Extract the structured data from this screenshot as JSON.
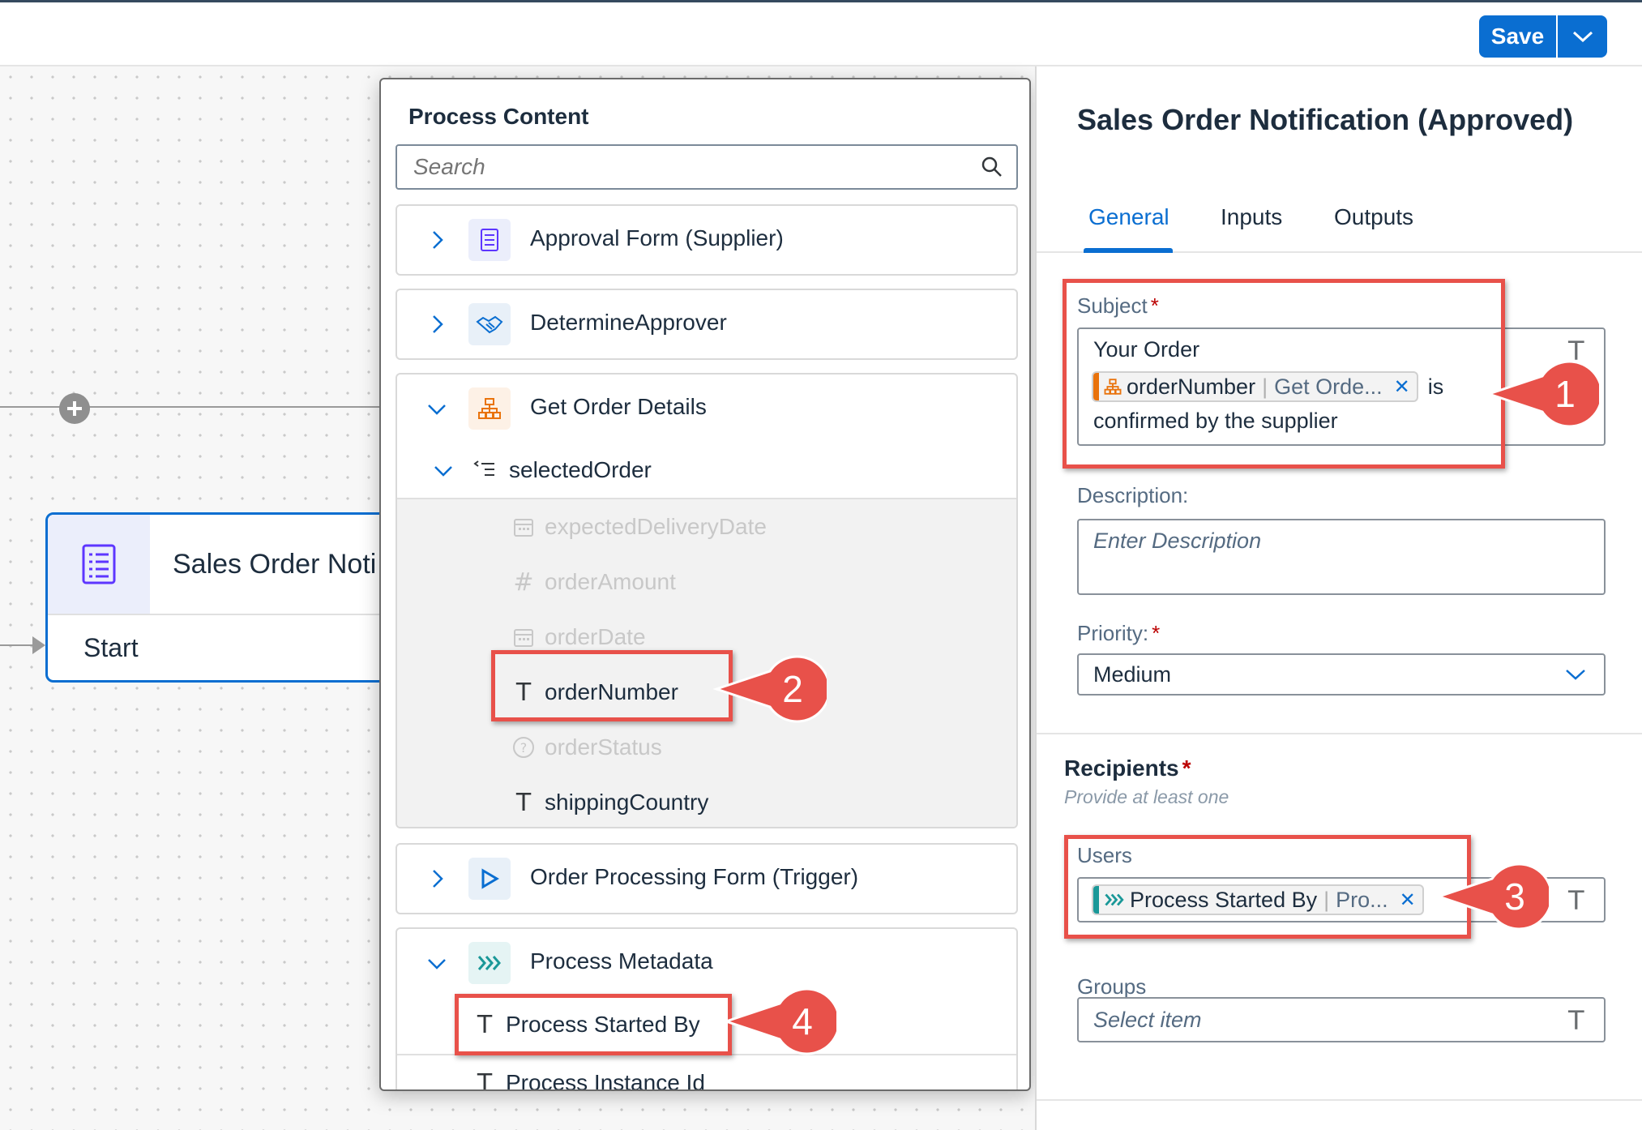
{
  "toolbar": {
    "save_label": "Save",
    "save_menu_icon": "chevron-down-icon",
    "accent_color": "#0a6ed1"
  },
  "canvas": {
    "add_node_icon": "plus-circle-icon",
    "task_card": {
      "title": "Sales Order Noti",
      "icon": "form-list-icon",
      "start_label": "Start"
    }
  },
  "process_content": {
    "title": "Process Content",
    "search_placeholder": "Search",
    "sections": [
      {
        "label": "Approval Form (Supplier)",
        "icon": "form-list-icon",
        "expanded": false
      },
      {
        "label": "DetermineApprover",
        "icon": "handshake-icon",
        "expanded": false
      },
      {
        "label": "Get Order Details",
        "icon": "hierarchy-icon",
        "expanded": true,
        "child_group": {
          "label": "selectedOrder",
          "icon": "list-indent-icon"
        },
        "fields": [
          {
            "label": "expectedDeliveryDate",
            "type_icon": "calendar-icon",
            "enabled": false
          },
          {
            "label": "orderAmount",
            "type_icon": "#",
            "enabled": false
          },
          {
            "label": "orderDate",
            "type_icon": "calendar-icon",
            "enabled": false
          },
          {
            "label": "orderNumber",
            "type_icon": "T",
            "enabled": true
          },
          {
            "label": "orderStatus",
            "type_icon": "question-icon",
            "enabled": false
          },
          {
            "label": "shippingCountry",
            "type_icon": "T",
            "enabled": true
          }
        ]
      },
      {
        "label": "Order Processing Form (Trigger)",
        "icon": "play-icon",
        "expanded": false
      },
      {
        "label": "Process Metadata",
        "icon": "process-arrows-icon",
        "expanded": true,
        "fields": [
          {
            "label": "Process Started By",
            "type_icon": "T"
          },
          {
            "label": "Process Instance Id",
            "type_icon": "T"
          }
        ]
      }
    ]
  },
  "details": {
    "title": "Sales Order Notification (Approved)",
    "tabs": [
      "General",
      "Inputs",
      "Outputs"
    ],
    "active_tab": "General",
    "subject": {
      "label": "Subject",
      "required": "*",
      "text_before": "Your Order",
      "token": {
        "name": "orderNumber",
        "source": "Get Orde...",
        "color": "#e9730c"
      },
      "text_after_token": "is",
      "text_line3": "confirmed by the supplier",
      "type_icon": "T"
    },
    "description": {
      "label": "Description:",
      "placeholder": "Enter Description"
    },
    "priority": {
      "label": "Priority:",
      "required": "*",
      "value": "Medium"
    },
    "recipients": {
      "heading": "Recipients",
      "required": "*",
      "hint": "Provide at least one",
      "users": {
        "label": "Users",
        "token": {
          "name": "Process Started By",
          "source": "Pro...",
          "color": "#1a9898"
        },
        "type_icon": "T"
      },
      "groups": {
        "label": "Groups",
        "placeholder": "Select item",
        "type_icon": "T"
      }
    }
  },
  "annotations": {
    "color": "#e8514a",
    "callouts": [
      "1",
      "2",
      "3",
      "4"
    ]
  }
}
